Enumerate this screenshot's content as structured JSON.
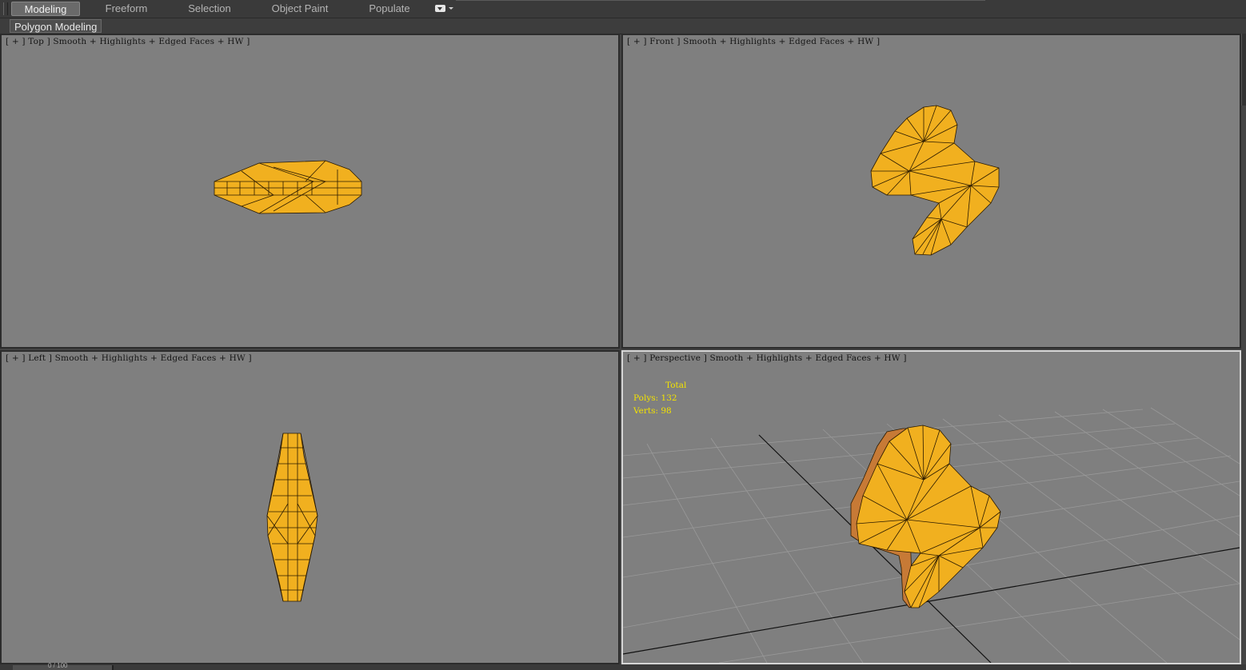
{
  "ribbon": {
    "tabs": [
      {
        "label": "Modeling",
        "active": true
      },
      {
        "label": "Freeform",
        "active": false
      },
      {
        "label": "Selection",
        "active": false
      },
      {
        "label": "Object Paint",
        "active": false
      },
      {
        "label": "Populate",
        "active": false
      }
    ],
    "panel_label": "Polygon Modeling"
  },
  "viewports": {
    "top": {
      "label": "[ + ] Top ] Smooth + Highlights + Edged Faces + HW ]"
    },
    "front": {
      "label": "[ + ] Front ] Smooth + Highlights + Edged Faces + HW ]"
    },
    "left": {
      "label": "[ + ] Left ] Smooth + Highlights + Edged Faces + HW ]"
    },
    "perspective": {
      "label": "[ + ] Perspective ] Smooth + Highlights + Edged Faces + HW ]",
      "stats": {
        "total": "Total",
        "polys": "Polys: 132",
        "verts": "Verts: 98"
      }
    }
  },
  "status": {
    "left_text": "0 / 100"
  },
  "colors": {
    "viewport_bg": "#7f7f7f",
    "object": "#f1b01f",
    "stats_text": "#f3e300"
  }
}
